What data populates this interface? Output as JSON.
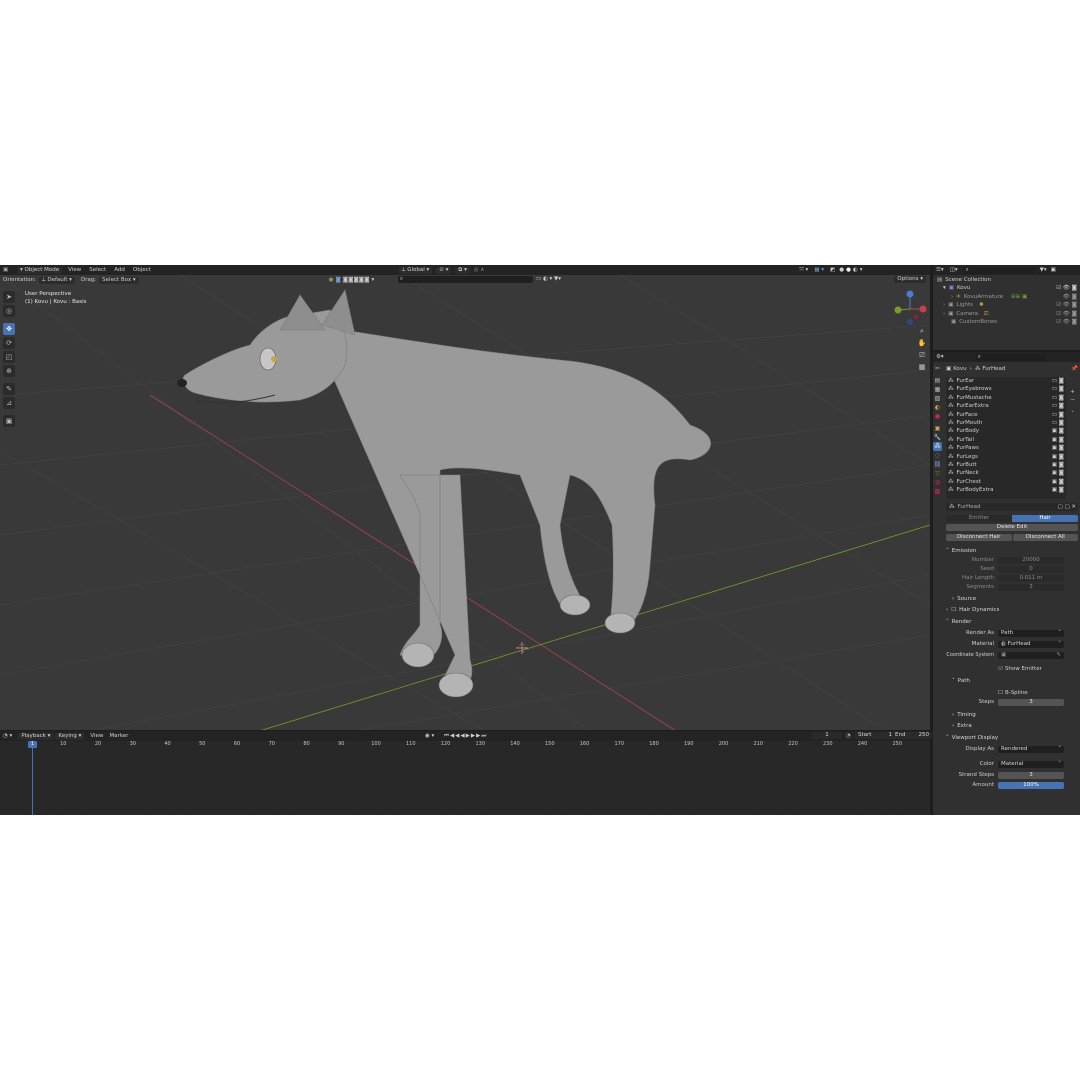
{
  "header": {
    "editor_icon": "viewport-icon",
    "mode": "Object Mode",
    "menus": [
      "View",
      "Select",
      "Add",
      "Object"
    ],
    "transform_orientation": "Global",
    "options_label": "Options"
  },
  "tool_settings": {
    "orientation_label": "Orientation:",
    "orientation_value": "Default",
    "drag_label": "Drag:",
    "drag_value": "Select Box"
  },
  "viewport": {
    "view_name": "User Perspective",
    "object_info": "(1) Kovu | Kovu : Basis"
  },
  "toolbar_tools": [
    "select-box",
    "cursor",
    "move",
    "rotate",
    "scale",
    "transform",
    "annotate",
    "measure",
    "add-cube"
  ],
  "timeline": {
    "menus": [
      "Playback",
      "Keying",
      "View",
      "Marker"
    ],
    "current_frame": "1",
    "start_label": "Start",
    "start_value": "1",
    "end_label": "End",
    "end_value": "250",
    "ticks": [
      "1",
      "10",
      "20",
      "30",
      "40",
      "50",
      "60",
      "70",
      "80",
      "90",
      "100",
      "110",
      "120",
      "130",
      "140",
      "150",
      "160",
      "170",
      "180",
      "190",
      "200",
      "210",
      "220",
      "230",
      "240",
      "250"
    ]
  },
  "outliner": {
    "root": "Scene Collection",
    "items": [
      {
        "name": "Kovu",
        "level": 0
      },
      {
        "name": "KovuArmature",
        "level": 1
      },
      {
        "name": "Lights",
        "level": 0
      },
      {
        "name": "Camera",
        "level": 0
      },
      {
        "name": "CustomBones",
        "level": 0
      }
    ]
  },
  "properties": {
    "breadcrumb_object": "Kovu",
    "breadcrumb_system": "FurHead",
    "particle_systems": [
      "FurEar",
      "FurEyebrows",
      "FurMustache",
      "FurEarExtra",
      "FurFace",
      "FurMouth",
      "FurBody",
      "FurTail",
      "FurPaws",
      "FurLegs",
      "FurButt",
      "FurNeck",
      "FurChest",
      "FurBodyExtra"
    ],
    "settings_name": "FurHead",
    "type_tabs": [
      "Emitter",
      "Hair"
    ],
    "active_type": "Hair",
    "delete_edit": "Delete Edit",
    "disconnect_hair": "Disconnect Hair",
    "disconnect_all": "Disconnect All",
    "emission": {
      "title": "Emission",
      "fields": [
        {
          "label": "Number",
          "value": "20000"
        },
        {
          "label": "Seed",
          "value": "0"
        },
        {
          "label": "Hair Length",
          "value": "0.011 m"
        },
        {
          "label": "Segments",
          "value": "3"
        }
      ]
    },
    "source": "Source",
    "hair_dynamics": "Hair Dynamics",
    "render": {
      "title": "Render",
      "render_as_label": "Render As",
      "render_as_value": "Path",
      "material_label": "Material",
      "material_value": "FurHead",
      "coord_label": "Coordinate System",
      "show_emitter": "Show Emitter",
      "path_title": "Path",
      "bspline": "B-Spline",
      "steps_label": "Steps",
      "steps_value": "3",
      "timing": "Timing",
      "extra": "Extra"
    },
    "viewport_display": {
      "title": "Viewport Display",
      "display_as_label": "Display As",
      "display_as_value": "Rendered",
      "color_label": "Color",
      "color_value": "Material",
      "strand_steps_label": "Strand Steps",
      "strand_steps_value": "3",
      "amount_label": "Amount",
      "amount_value": "100%",
      "amount_fraction": 1.0
    }
  },
  "colors": {
    "accent": "#4772b3",
    "viewport_bg": "#393939",
    "panel_bg": "#303030",
    "header_bg": "#232323",
    "x_axis": "#b0414c",
    "y_axis": "#7a9a2c"
  }
}
